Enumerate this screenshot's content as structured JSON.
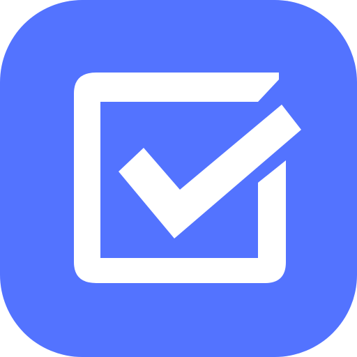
{
  "icon": {
    "name": "checkbox-checked-icon",
    "background_color": "#5373FF",
    "foreground_color": "#FFFFFF"
  }
}
